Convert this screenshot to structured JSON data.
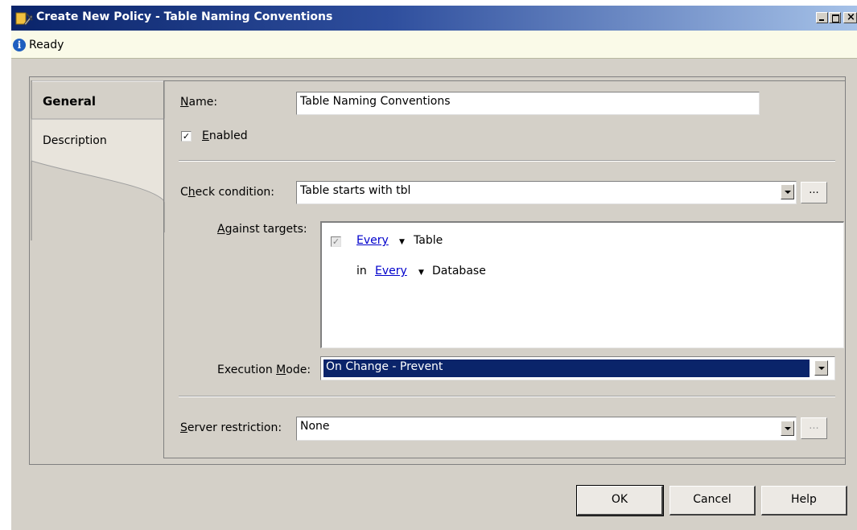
{
  "window": {
    "title": "Create New Policy - Table Naming Conventions"
  },
  "status": {
    "text": "Ready"
  },
  "tabs": [
    {
      "label": "General"
    },
    {
      "label": "Description"
    }
  ],
  "form": {
    "name": {
      "label_accel": "N",
      "label_rest": "ame:",
      "value": "Table Naming Conventions"
    },
    "enabled": {
      "accel": "E",
      "rest": "nabled",
      "checked": true,
      "check_mark": "✓"
    },
    "check_condition": {
      "label_pre": "C",
      "label_accel": "h",
      "label_rest": "eck condition:",
      "value": "Table starts with tbl",
      "ellipsis": "..."
    },
    "against_targets": {
      "label_accel": "A",
      "label_rest": "gainst targets:",
      "rows": [
        {
          "prefix": "",
          "link": "Every",
          "target": "Table"
        },
        {
          "prefix": "in",
          "link": "Every",
          "target": "Database"
        }
      ],
      "check_mark": "✓"
    },
    "execution_mode": {
      "label_pre": "Execution ",
      "label_accel": "M",
      "label_rest": "ode:",
      "value": "On Change - Prevent"
    },
    "server_restriction": {
      "label_accel": "S",
      "label_rest": "erver restriction:",
      "value": "None",
      "ellipsis": "..."
    }
  },
  "buttons": {
    "ok": "OK",
    "cancel": "Cancel",
    "help": "Help"
  }
}
